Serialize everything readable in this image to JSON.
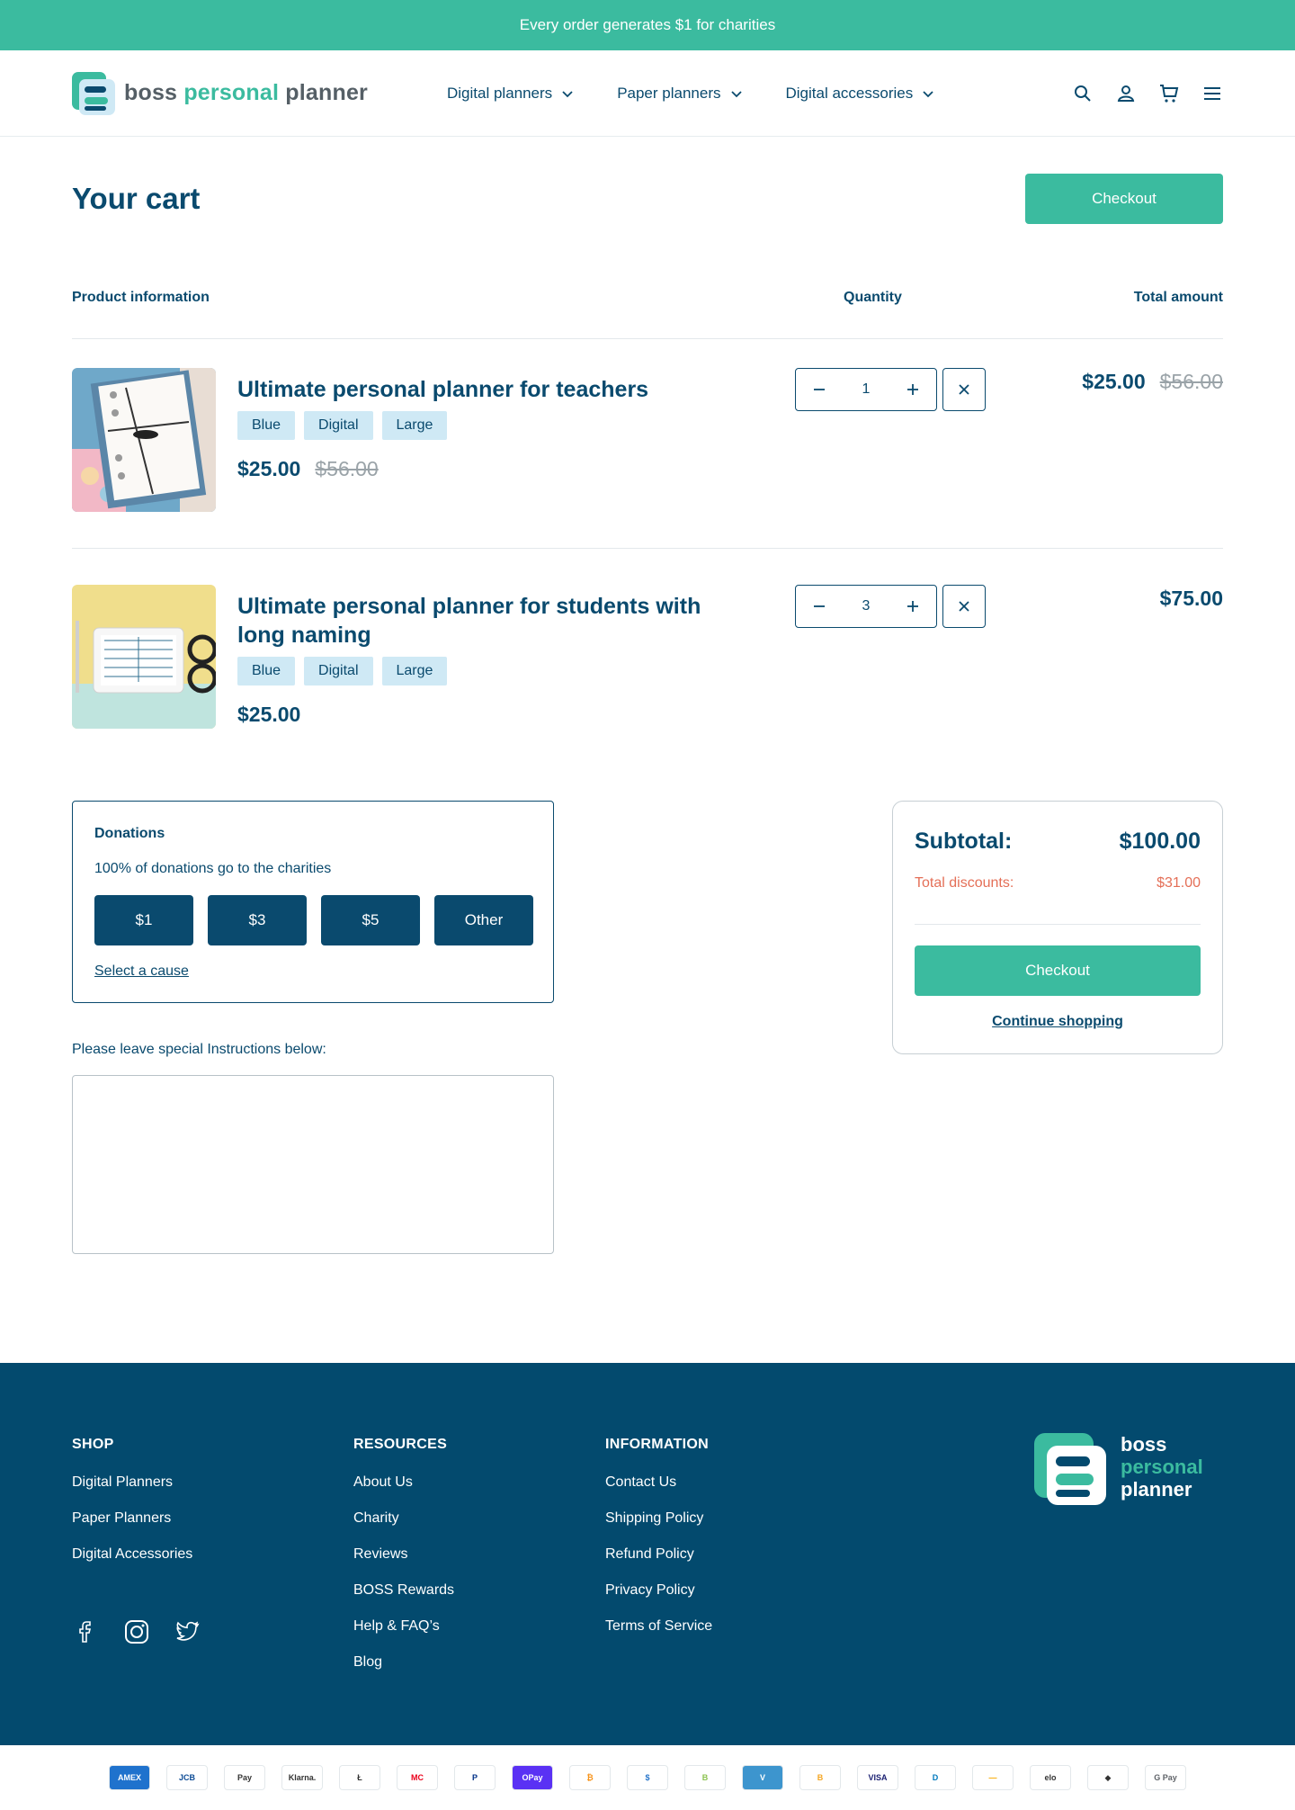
{
  "announcement": "Every order generates $1 for charities",
  "brand": {
    "name_part1": "boss",
    "name_part2": "personal",
    "name_part3": "planner"
  },
  "nav": [
    {
      "label": "Digital planners"
    },
    {
      "label": "Paper planners"
    },
    {
      "label": "Digital accessories"
    }
  ],
  "header_icons": [
    "search-icon",
    "account-icon",
    "cart-icon",
    "menu-icon"
  ],
  "cart": {
    "title": "Your cart",
    "checkout_label": "Checkout",
    "columns": {
      "product": "Product information",
      "quantity": "Quantity",
      "total": "Total amount"
    },
    "items": [
      {
        "title": "Ultimate personal planner for teachers",
        "tags": [
          "Blue",
          "Digital",
          "Large"
        ],
        "price": "$25.00",
        "old_price": "$56.00",
        "quantity": "1",
        "total": "$25.00",
        "total_old": "$56.00"
      },
      {
        "title": "Ultimate personal planner for students with long naming",
        "tags": [
          "Blue",
          "Digital",
          "Large"
        ],
        "price": "$25.00",
        "old_price": "",
        "quantity": "3",
        "total": "$75.00",
        "total_old": ""
      }
    ]
  },
  "donations": {
    "title": "Donations",
    "subtitle": "100% of donations go to the charities",
    "options": [
      "$1",
      "$3",
      "$5",
      "Other"
    ],
    "cause_link": "Select a cause"
  },
  "instructions": {
    "label": "Please leave special Instructions below:"
  },
  "summary": {
    "subtotal_label": "Subtotal:",
    "subtotal_value": "$100.00",
    "discount_label": "Total discounts:",
    "discount_value": "$31.00",
    "checkout_label": "Checkout",
    "continue_label": "Continue shopping"
  },
  "footer": {
    "shop": {
      "heading": "SHOP",
      "links": [
        "Digital Planners",
        "Paper Planners",
        "Digital Accessories"
      ]
    },
    "resources": {
      "heading": "RESOURCES",
      "links": [
        "About Us",
        "Charity",
        "Reviews",
        "BOSS Rewards",
        "Help & FAQ’s",
        "Blog"
      ]
    },
    "information": {
      "heading": "INFORMATION",
      "links": [
        "Contact Us",
        "Shipping Policy",
        "Refund Policy",
        "Privacy Policy",
        "Terms of Service"
      ]
    },
    "social": [
      "facebook-icon",
      "instagram-icon",
      "twitter-icon"
    ]
  },
  "payments": [
    "AMEX",
    "JCB",
    "Pay",
    "Klarna.",
    "Ł",
    "MC",
    "P",
    "OPay",
    "₿",
    "$",
    "B",
    "V",
    "B",
    "VISA",
    "D",
    "—",
    "elo",
    "◆",
    "G Pay"
  ],
  "colors": {
    "primary": "#0a4a6e",
    "accent": "#3bbb9f",
    "footer": "#034a6e",
    "discount": "#e46f57",
    "tag": "#cfe9f5"
  }
}
